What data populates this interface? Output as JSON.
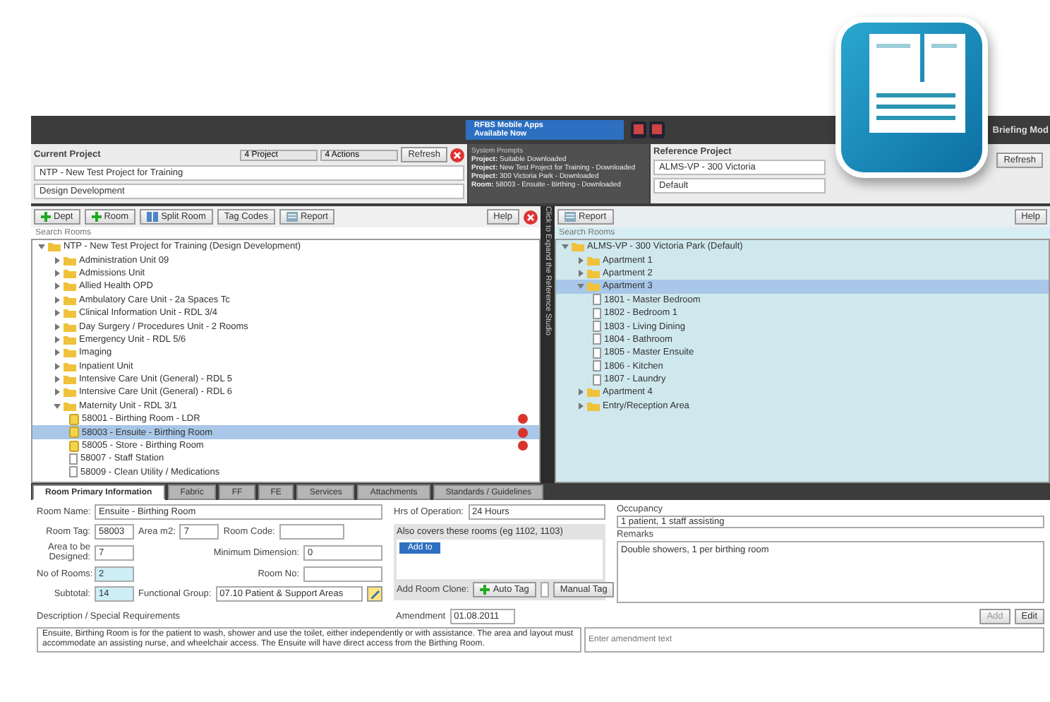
{
  "header": {
    "banner": [
      "RFBS Mobile Apps",
      "Available Now"
    ],
    "title": "Briefing Mod"
  },
  "current_project": {
    "label": "Current Project",
    "menus": [
      "4 Project",
      "4 Actions"
    ],
    "refresh": "Refresh",
    "project": "NTP - New Test Project for Training",
    "stage": "Design Development"
  },
  "system_prompts": {
    "title": "System Prompts",
    "lines": [
      {
        "key": "Project:",
        "value": "Suitable Downloaded"
      },
      {
        "key": "Project:",
        "value": "New Test Project for Training - Downloaded"
      },
      {
        "key": "Project:",
        "value": "300 Victoria Park - Downloaded"
      },
      {
        "key": "Room:",
        "value": "58003 - Ensuite - Birthing - Downloaded"
      }
    ]
  },
  "reference_project": {
    "label": "Reference Project",
    "project": "ALMS-VP - 300 Victoria",
    "stage": "Default",
    "refresh": "Refresh"
  },
  "left_toolbar": {
    "buttons": [
      {
        "label": "Dept",
        "kind": "add"
      },
      {
        "label": "Room",
        "kind": "add"
      },
      {
        "label": "Split Room",
        "kind": "split"
      },
      {
        "label": "Tag Codes",
        "kind": "plain"
      },
      {
        "label": "Report",
        "kind": "report"
      }
    ],
    "help": "Help",
    "search": {
      "placeholder": "Search Rooms"
    }
  },
  "left_tree": [
    {
      "label": "NTP - New Test Project for Training (Design Development)",
      "kind": "folder",
      "expanded": true,
      "selected": false,
      "warning": false,
      "children": [
        {
          "label": "Administration Unit 09",
          "kind": "folder",
          "expanded": false,
          "selected": false,
          "warning": false
        },
        {
          "label": "Admissions Unit",
          "kind": "folder",
          "expanded": false,
          "selected": false,
          "warning": false
        },
        {
          "label": "Allied Health OPD",
          "kind": "folder",
          "expanded": false,
          "selected": false,
          "warning": false
        },
        {
          "label": "Ambulatory Care Unit - 2a Spaces Tc",
          "kind": "folder",
          "expanded": false,
          "selected": false,
          "warning": false
        },
        {
          "label": "Clinical Information Unit - RDL 3/4",
          "kind": "folder",
          "expanded": false,
          "selected": false,
          "warning": false
        },
        {
          "label": "Day Surgery / Procedures Unit - 2 Rooms",
          "kind": "folder",
          "expanded": false,
          "selected": false,
          "warning": false
        },
        {
          "label": "Emergency Unit - RDL 5/6",
          "kind": "folder",
          "expanded": false,
          "selected": false,
          "warning": false
        },
        {
          "label": "Imaging",
          "kind": "folder",
          "expanded": false,
          "selected": false,
          "warning": false
        },
        {
          "label": "Inpatient Unit",
          "kind": "folder",
          "expanded": false,
          "selected": false,
          "warning": false
        },
        {
          "label": "Intensive Care Unit (General) - RDL 5",
          "kind": "folder",
          "expanded": false,
          "selected": false,
          "warning": false
        },
        {
          "label": "Intensive Care Unit (General) - RDL 6",
          "kind": "folder",
          "expanded": false,
          "selected": false,
          "warning": false
        },
        {
          "label": "Maternity Unit - RDL 3/1",
          "kind": "folder",
          "expanded": true,
          "selected": false,
          "warning": false,
          "children": [
            {
              "label": "58001 - Birthing Room - LDR",
              "kind": "room-open",
              "selected": false,
              "warning": true
            },
            {
              "label": "58003 - Ensuite - Birthing Room",
              "kind": "room-open",
              "selected": true,
              "warning": true
            },
            {
              "label": "58005 - Store - Birthing Room",
              "kind": "room-open",
              "selected": false,
              "warning": true
            },
            {
              "label": "58007 - Staff Station",
              "kind": "room",
              "selected": false,
              "warning": false
            },
            {
              "label": "58009 - Clean Utility / Medications",
              "kind": "room",
              "selected": false,
              "warning": false
            }
          ]
        }
      ]
    }
  ],
  "side_strip": "Click to Expand the Reference Studio",
  "right_toolbar": {
    "report": "Report",
    "help": "Help",
    "search": {
      "placeholder": "Search Rooms"
    }
  },
  "right_tree": [
    {
      "label": "ALMS-VP - 300 Victoria Park (Default)",
      "kind": "folder",
      "expanded": true,
      "selected": false,
      "children": [
        {
          "label": "Apartment 1",
          "kind": "folder",
          "expanded": false,
          "selected": false
        },
        {
          "label": "Apartment 2",
          "kind": "folder",
          "expanded": false,
          "selected": false
        },
        {
          "label": "Apartment 3",
          "kind": "folder",
          "expanded": true,
          "selected": true,
          "children": [
            {
              "label": "1801 - Master Bedroom",
              "kind": "room",
              "selected": false
            },
            {
              "label": "1802 - Bedroom 1",
              "kind": "room",
              "selected": false
            },
            {
              "label": "1803 - Living Dining",
              "kind": "room",
              "selected": false
            },
            {
              "label": "1804 - Bathroom",
              "kind": "room",
              "selected": false
            },
            {
              "label": "1805 - Master Ensuite",
              "kind": "room",
              "selected": false
            },
            {
              "label": "1806 - Kitchen",
              "kind": "room",
              "selected": false
            },
            {
              "label": "1807 - Laundry",
              "kind": "room",
              "selected": false
            }
          ]
        },
        {
          "label": "Apartment 4",
          "kind": "folder",
          "expanded": false,
          "selected": false
        },
        {
          "label": "Entry/Reception Area",
          "kind": "folder",
          "expanded": false,
          "selected": false
        }
      ]
    }
  ],
  "tabs": [
    {
      "label": "Room Primary Information",
      "selected": true
    },
    {
      "label": "Fabric",
      "selected": false
    },
    {
      "label": "FF",
      "selected": false
    },
    {
      "label": "FE",
      "selected": false
    },
    {
      "label": "Services",
      "selected": false
    },
    {
      "label": "Attachments",
      "selected": false
    },
    {
      "label": "Standards / Guidelines",
      "selected": false
    }
  ],
  "form": {
    "room_name": {
      "label": "Room Name:",
      "value": "Ensuite - Birthing Room"
    },
    "room_tag": {
      "label": "Room Tag:",
      "value": "58003"
    },
    "area": {
      "label": "Area m2:",
      "value": "7"
    },
    "room_code": {
      "label": "Room Code:"
    },
    "area_designed": {
      "label": "Area to be Designed:",
      "value": "7"
    },
    "min_dimension": {
      "label": "Minimum Dimension:",
      "value": "0"
    },
    "no_rooms": {
      "label": "No of Rooms:",
      "value": "2"
    },
    "room_no": {
      "label": "Room No:"
    },
    "subtotal": {
      "label": "Subtotal:",
      "value": "14"
    },
    "functional_group": {
      "label": "Functional Group:",
      "value": "07.10 Patient & Support Areas"
    },
    "hours": {
      "label": "Hrs of Operation:",
      "value": "24 Hours"
    },
    "covers": "Also covers these rooms (eg 1102, 1103)",
    "covers_button": "Add to",
    "clone_label": "Add Room Clone:",
    "auto_tag": "Auto Tag",
    "manual_tag": "Manual Tag",
    "occupancy": {
      "label": "Occupancy",
      "value": "1 patient, 1 staff assisting"
    },
    "remarks": {
      "label": "Remarks",
      "value": "Double showers, 1 per birthing room"
    },
    "amendment": {
      "label": "Amendment",
      "value": "01.08.2011"
    },
    "add": "Add",
    "edit": "Edit",
    "description": {
      "label": "Description / Special Requirements",
      "value": "Ensuite, Birthing Room is for the patient to wash, shower and use the toilet, either independently or with assistance. The area and layout must accommodate an assisting nurse, and wheelchair access.  The Ensuite will have direct access from the Birthing Room."
    },
    "amendment_text": {
      "placeholder": "Enter amendment text"
    }
  }
}
